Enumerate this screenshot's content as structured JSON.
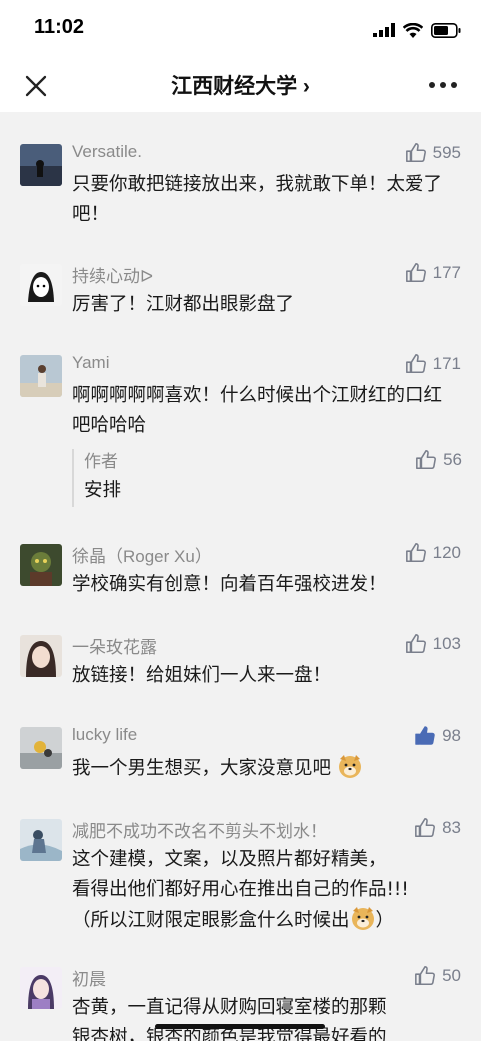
{
  "status_bar": {
    "time": "11:02"
  },
  "nav": {
    "title": "江西财经大学 ›"
  },
  "comments": [
    {
      "user": "Versatile.",
      "likes": "595",
      "text": "只要你敢把链接放出来，我就敢下单！太爱了吧！"
    },
    {
      "user": "持续心动ᐅ",
      "likes": "177",
      "text": "厉害了！江财都出眼影盘了"
    },
    {
      "user": "Yami",
      "likes": "171",
      "text": "啊啊啊啊啊喜欢！什么时候出个江财红的口红吧哈哈哈",
      "reply": {
        "user": "作者",
        "likes": "56",
        "text": "安排"
      }
    },
    {
      "user": "徐晶（Roger Xu）",
      "likes": "120",
      "text": "学校确实有创意！向着百年强校进发！"
    },
    {
      "user": "一朵玫花露",
      "likes": "103",
      "text": "放链接！给姐妹们一人来一盘！"
    },
    {
      "user": "lucky life",
      "likes": "98",
      "text": "我一个男生想买，大家没意见吧"
    },
    {
      "user": "减肥不成功不改名不剪头不划水！",
      "likes": "83",
      "text_lines": [
        "这个建模，文案，以及照片都好精美，",
        "看得出他们都好用心在推出自己的作品!!!",
        "（所以江财限定眼影盒什么时候出"
      ],
      "text_tail": "）"
    },
    {
      "user": "初晨",
      "likes": "50",
      "text_lines": [
        "杏黄，一直记得从财购回寝室楼的那颗",
        "银杏树，银杏的颜色是我觉得最好看的"
      ]
    }
  ],
  "colors": {
    "like_active": "#4a6bb5",
    "like_idle": "#7a7f8c",
    "username": "#8a8a8a"
  }
}
